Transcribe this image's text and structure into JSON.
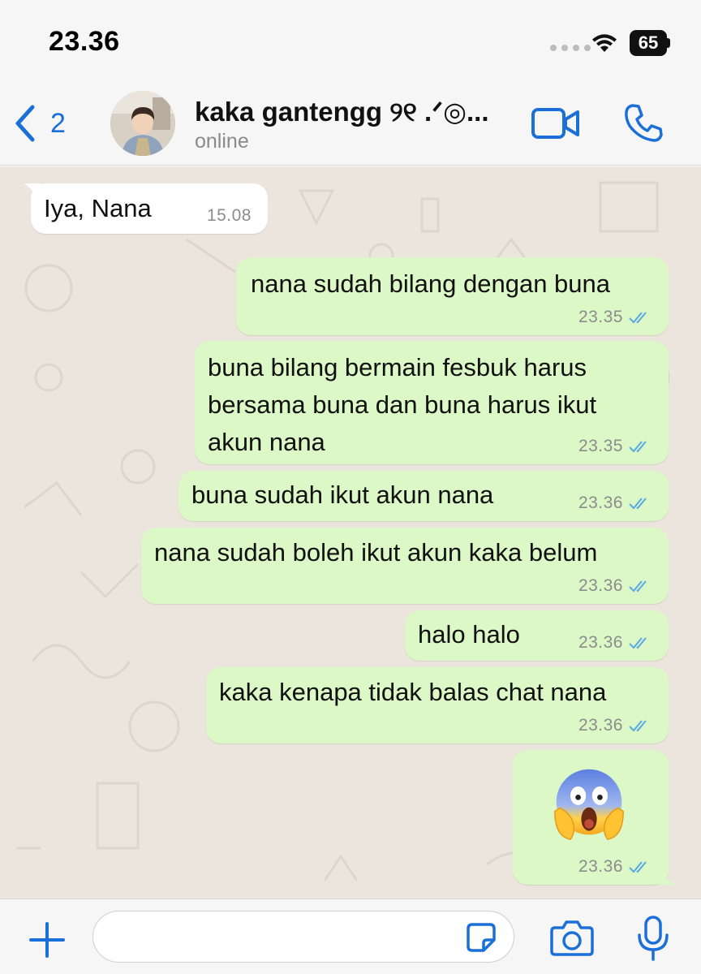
{
  "status_bar": {
    "time": "23.36",
    "battery": "65"
  },
  "header": {
    "back_count": "2",
    "contact_name": "kaka gantengg ୨୧ .ᐟ◎...",
    "contact_status": "online"
  },
  "messages": [
    {
      "direction": "in",
      "text": "Iya, Nana",
      "time": "15.08"
    },
    {
      "direction": "out",
      "text": "nana sudah bilang dengan buna",
      "time": "23.35",
      "read": true
    },
    {
      "direction": "out",
      "lines": [
        "buna bilang bermain fesbuk harus",
        "bersama buna dan buna harus ikut",
        "akun nana"
      ],
      "time": "23.35",
      "read": true
    },
    {
      "direction": "out",
      "text": "buna sudah ikut akun nana",
      "time": "23.36",
      "read": true
    },
    {
      "direction": "out",
      "text": "nana sudah boleh ikut akun kaka belum",
      "time": "23.36",
      "read": true
    },
    {
      "direction": "out",
      "text": "halo halo",
      "time": "23.36",
      "read": true
    },
    {
      "direction": "out",
      "text": "kaka kenapa tidak balas chat nana",
      "time": "23.36",
      "read": true
    },
    {
      "direction": "out",
      "emoji": "screaming-in-fear-emoji",
      "time": "23.36",
      "read": true
    }
  ],
  "input_bar": {
    "placeholder": ""
  },
  "colors": {
    "accent": "#1b6fd8",
    "outgoing_bubble": "#dcf8c6",
    "incoming_bubble": "#ffffff",
    "chat_background": "#ece5dd",
    "read_ticks": "#5aa9e6"
  },
  "icons": [
    "back-chevron-icon",
    "video-call-icon",
    "phone-icon",
    "plus-icon",
    "sticker-icon",
    "camera-icon",
    "microphone-icon"
  ]
}
